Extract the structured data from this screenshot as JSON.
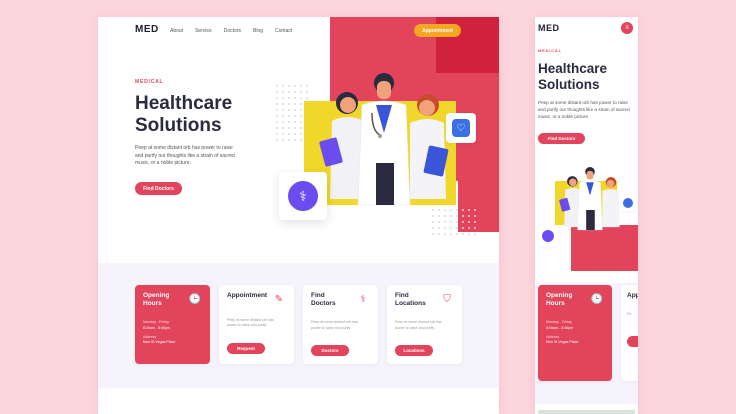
{
  "desktop": {
    "logo": "MED",
    "nav": [
      "About",
      "Service",
      "Doctors",
      "Blog",
      "Contact"
    ],
    "appointment_button": "Appointment",
    "kicker": "MEDICAL",
    "title_line1": "Healthcare",
    "title_line2": "Solutions",
    "description": "Peep at some distant orb has power to raise and purify our thoughts like a strain of sacred music, or a noble picture.",
    "cta": "Find Doctors",
    "cards": [
      {
        "title": "Opening Hours",
        "line1": "Monday - Friday",
        "line2": "8:00am - 5:00pm",
        "line3": "Address",
        "line4": "Mon St Vegas Place",
        "icon": "clock-icon"
      },
      {
        "title": "Appointment",
        "text": "Peep at some distant orb has power to raise and purify",
        "button": "Request",
        "icon": "edit-icon"
      },
      {
        "title": "Find Doctors",
        "text": "Peep at some distant orb has power to raise and purify",
        "button": "Doctors",
        "icon": "doctor-icon"
      },
      {
        "title": "Find Locations",
        "text": "Peep at some distant orb has power to raise and purify",
        "button": "Locations",
        "icon": "location-shield-icon"
      }
    ]
  },
  "mobile": {
    "logo": "MED",
    "kicker": "MEDICAL",
    "title_line1": "Healthcare",
    "title_line2": "Solutions",
    "description": "Peep at some distant orb has power to raise and purify our thoughts like a strain of sacred music, or a noble picture.",
    "cta": "Find Doctors",
    "card1_title": "Opening Hours",
    "card1_line1": "Monday - Friday",
    "card1_line2": "8:00am - 5:00pm",
    "card1_line3": "Address",
    "card1_line4": "Mon St Vegas Place",
    "card2_title": "Appointment"
  },
  "colors": {
    "accent": "#e2445c",
    "yellow": "#f2d72b",
    "orange": "#f5a623",
    "purple": "#6a4cf0",
    "background": "#fcd6dd"
  }
}
